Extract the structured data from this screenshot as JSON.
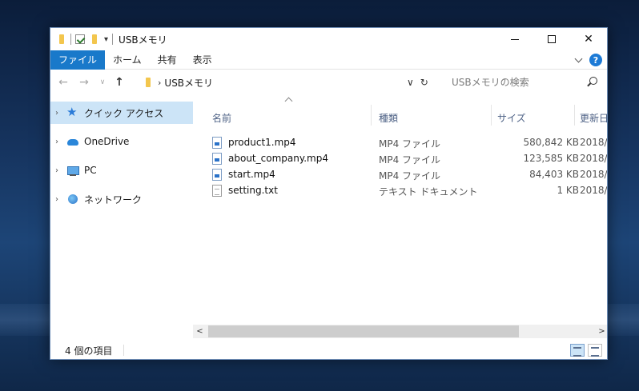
{
  "window": {
    "title": "USBメモリ"
  },
  "ribbon": {
    "tabs": [
      "ファイル",
      "ホーム",
      "共有",
      "表示"
    ],
    "help_label": "?"
  },
  "navbar": {
    "back": "←",
    "forward": "→",
    "recent": "∨",
    "up": "↑",
    "breadcrumb": [
      "USBメモリ"
    ],
    "breadcrumb_sep": "›",
    "dropdown": "∨",
    "refresh": "↻",
    "search_placeholder": "USBメモリの検索"
  },
  "navpane": {
    "items": [
      {
        "label": "クイック アクセス",
        "icon": "star-icon"
      },
      {
        "label": "OneDrive",
        "icon": "cloud-icon"
      },
      {
        "label": "PC",
        "icon": "pc-icon"
      },
      {
        "label": "ネットワーク",
        "icon": "network-icon"
      }
    ],
    "expander": "›"
  },
  "columns": {
    "name": "名前",
    "type": "種類",
    "size": "サイズ",
    "date": "更新日"
  },
  "files": [
    {
      "name": "product1.mp4",
      "type": "MP4 ファイル",
      "size": "580,842 KB",
      "date": "2018/",
      "kind": "video"
    },
    {
      "name": "about_company.mp4",
      "type": "MP4 ファイル",
      "size": "123,585 KB",
      "date": "2018/",
      "kind": "video"
    },
    {
      "name": "start.mp4",
      "type": "MP4 ファイル",
      "size": "84,403 KB",
      "date": "2018/",
      "kind": "video"
    },
    {
      "name": "setting.txt",
      "type": "テキスト ドキュメント",
      "size": "1 KB",
      "date": "2018/",
      "kind": "text"
    }
  ],
  "scrollbar": {
    "left": "<",
    "right": ">"
  },
  "status": {
    "item_count": "4 個の項目"
  },
  "colors": {
    "accent": "#1979ca",
    "selection": "#cce4f7",
    "folder": "#f3c64d"
  }
}
